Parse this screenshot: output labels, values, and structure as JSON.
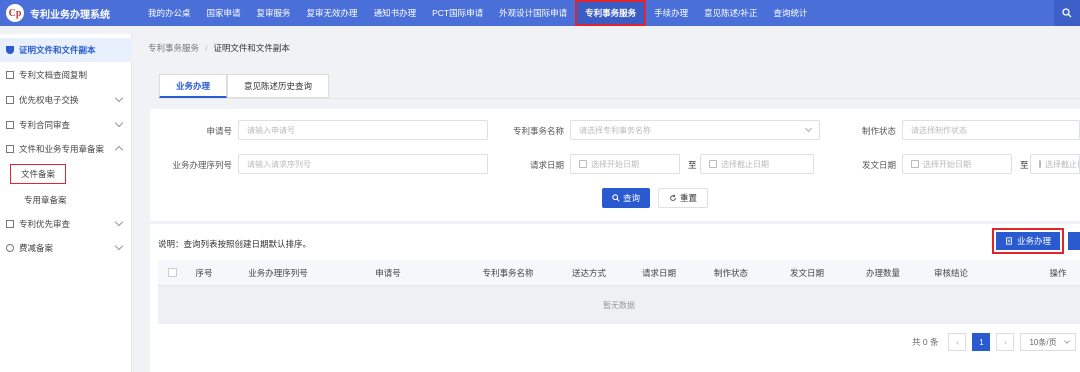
{
  "app": {
    "title": "专利业务办理系统",
    "logo_text": "Cp"
  },
  "nav": {
    "items": [
      {
        "label": "我的办公桌"
      },
      {
        "label": "国家申请"
      },
      {
        "label": "复审服务"
      },
      {
        "label": "复审无效办理"
      },
      {
        "label": "通知书办理"
      },
      {
        "label": "PCT国际申请"
      },
      {
        "label": "外观设计国际申请"
      },
      {
        "label": "专利事务服务",
        "active": true
      },
      {
        "label": "手续办理"
      },
      {
        "label": "意见陈述/补正"
      },
      {
        "label": "查询统计"
      }
    ]
  },
  "sidebar": {
    "items": [
      {
        "label": "证明文件和文件副本",
        "active": true
      },
      {
        "label": "专利文档查阅复制"
      },
      {
        "label": "优先权电子交换"
      },
      {
        "label": "专利合同审查"
      },
      {
        "label": "文件和业务专用章备案"
      },
      {
        "label": "专利优先审查"
      },
      {
        "label": "费减备案"
      }
    ],
    "subitems": [
      {
        "label": "文件备案"
      },
      {
        "label": "专用章备案"
      }
    ]
  },
  "breadcrumb": {
    "parent": "专利事务服务",
    "separator": "/",
    "current": "证明文件和文件副本"
  },
  "tabs": [
    {
      "label": "业务办理",
      "active": true
    },
    {
      "label": "意见陈述历史查询"
    }
  ],
  "form": {
    "application_no": {
      "label": "申请号",
      "placeholder": "请输入申请号"
    },
    "service_name": {
      "label": "专利事务名称",
      "placeholder": "请选择专利事务名称"
    },
    "make_status": {
      "label": "制作状态",
      "placeholder": "请选择制作状态"
    },
    "serial_no": {
      "label": "业务办理序列号",
      "placeholder": "请输入请求序列号"
    },
    "request_date": {
      "label": "请求日期",
      "start": "选择开始日期",
      "to": "至",
      "end": "选择截止日期"
    },
    "send_date": {
      "label": "发文日期",
      "start": "选择开始日期",
      "to": "至",
      "end": "选择截止日期"
    },
    "search_button": "查询",
    "reset_button": "重置"
  },
  "list": {
    "note": "说明：查询列表按照创建日期默认排序。",
    "handle_button": "业务办理",
    "columns": [
      "序号",
      "业务办理序列号",
      "申请号",
      "专利事务名称",
      "送达方式",
      "请求日期",
      "制作状态",
      "发文日期",
      "办理数量",
      "审核结论",
      "操作"
    ],
    "empty_text": "暂无数据"
  },
  "pagination": {
    "total": "共 0 条",
    "current_page": "1",
    "page_size": "10条/页"
  },
  "colors": {
    "primary": "#2a5ad0",
    "topbar": "#4a6fd8",
    "highlight_border": "#e0262c"
  }
}
